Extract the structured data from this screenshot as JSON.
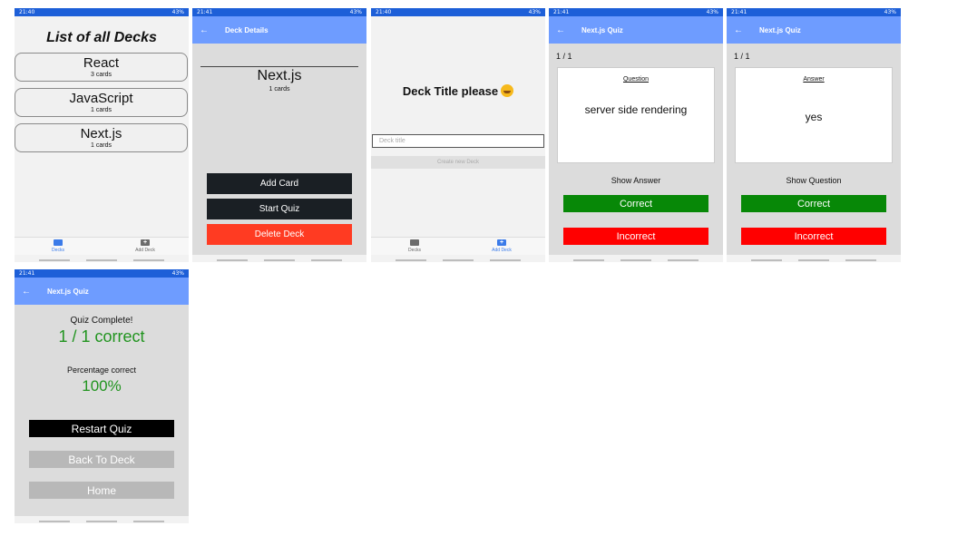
{
  "status": {
    "s1_time": "21:40",
    "s2_time": "21:41",
    "s3_time": "21:40",
    "s4_time": "21:41",
    "s5_time": "21:41",
    "s6_time": "21:41",
    "battery": "43%"
  },
  "decks_screen": {
    "title": "List of all Decks",
    "decks": [
      {
        "name": "React",
        "count": "3 cards"
      },
      {
        "name": "JavaScript",
        "count": "1 cards"
      },
      {
        "name": "Next.js",
        "count": "1 cards"
      }
    ]
  },
  "tabs": {
    "decks": "Decks",
    "add_deck": "Add Deck"
  },
  "details_screen": {
    "header": "Deck Details",
    "deck_name": "Next.js",
    "deck_count": "1 cards",
    "add_card": "Add Card",
    "start_quiz": "Start Quiz",
    "delete_deck": "Delete Deck"
  },
  "new_deck_screen": {
    "title": "Deck Title please",
    "placeholder": "Deck title",
    "create_button": "Create new Deck"
  },
  "quiz_question": {
    "header": "Next.js Quiz",
    "counter": "1 / 1",
    "label": "Question",
    "text": "server side rendering",
    "toggle": "Show Answer",
    "correct": "Correct",
    "incorrect": "Incorrect"
  },
  "quiz_answer": {
    "header": "Next.js Quiz",
    "counter": "1 / 1",
    "label": "Answer",
    "text": "yes",
    "toggle": "Show Question",
    "correct": "Correct",
    "incorrect": "Incorrect"
  },
  "results_screen": {
    "header": "Next.js Quiz",
    "complete": "Quiz Complete!",
    "score": "1 / 1 correct",
    "percent_label": "Percentage correct",
    "percent_value": "100%",
    "restart": "Restart Quiz",
    "back": "Back To Deck",
    "home": "Home"
  },
  "colors": {
    "header_blue": "#6e9cff",
    "status_blue": "#1d5fd8",
    "correct_green": "#078807",
    "incorrect_red": "#ff0000",
    "delete_red": "#ff3b22",
    "score_green": "#21941f"
  }
}
